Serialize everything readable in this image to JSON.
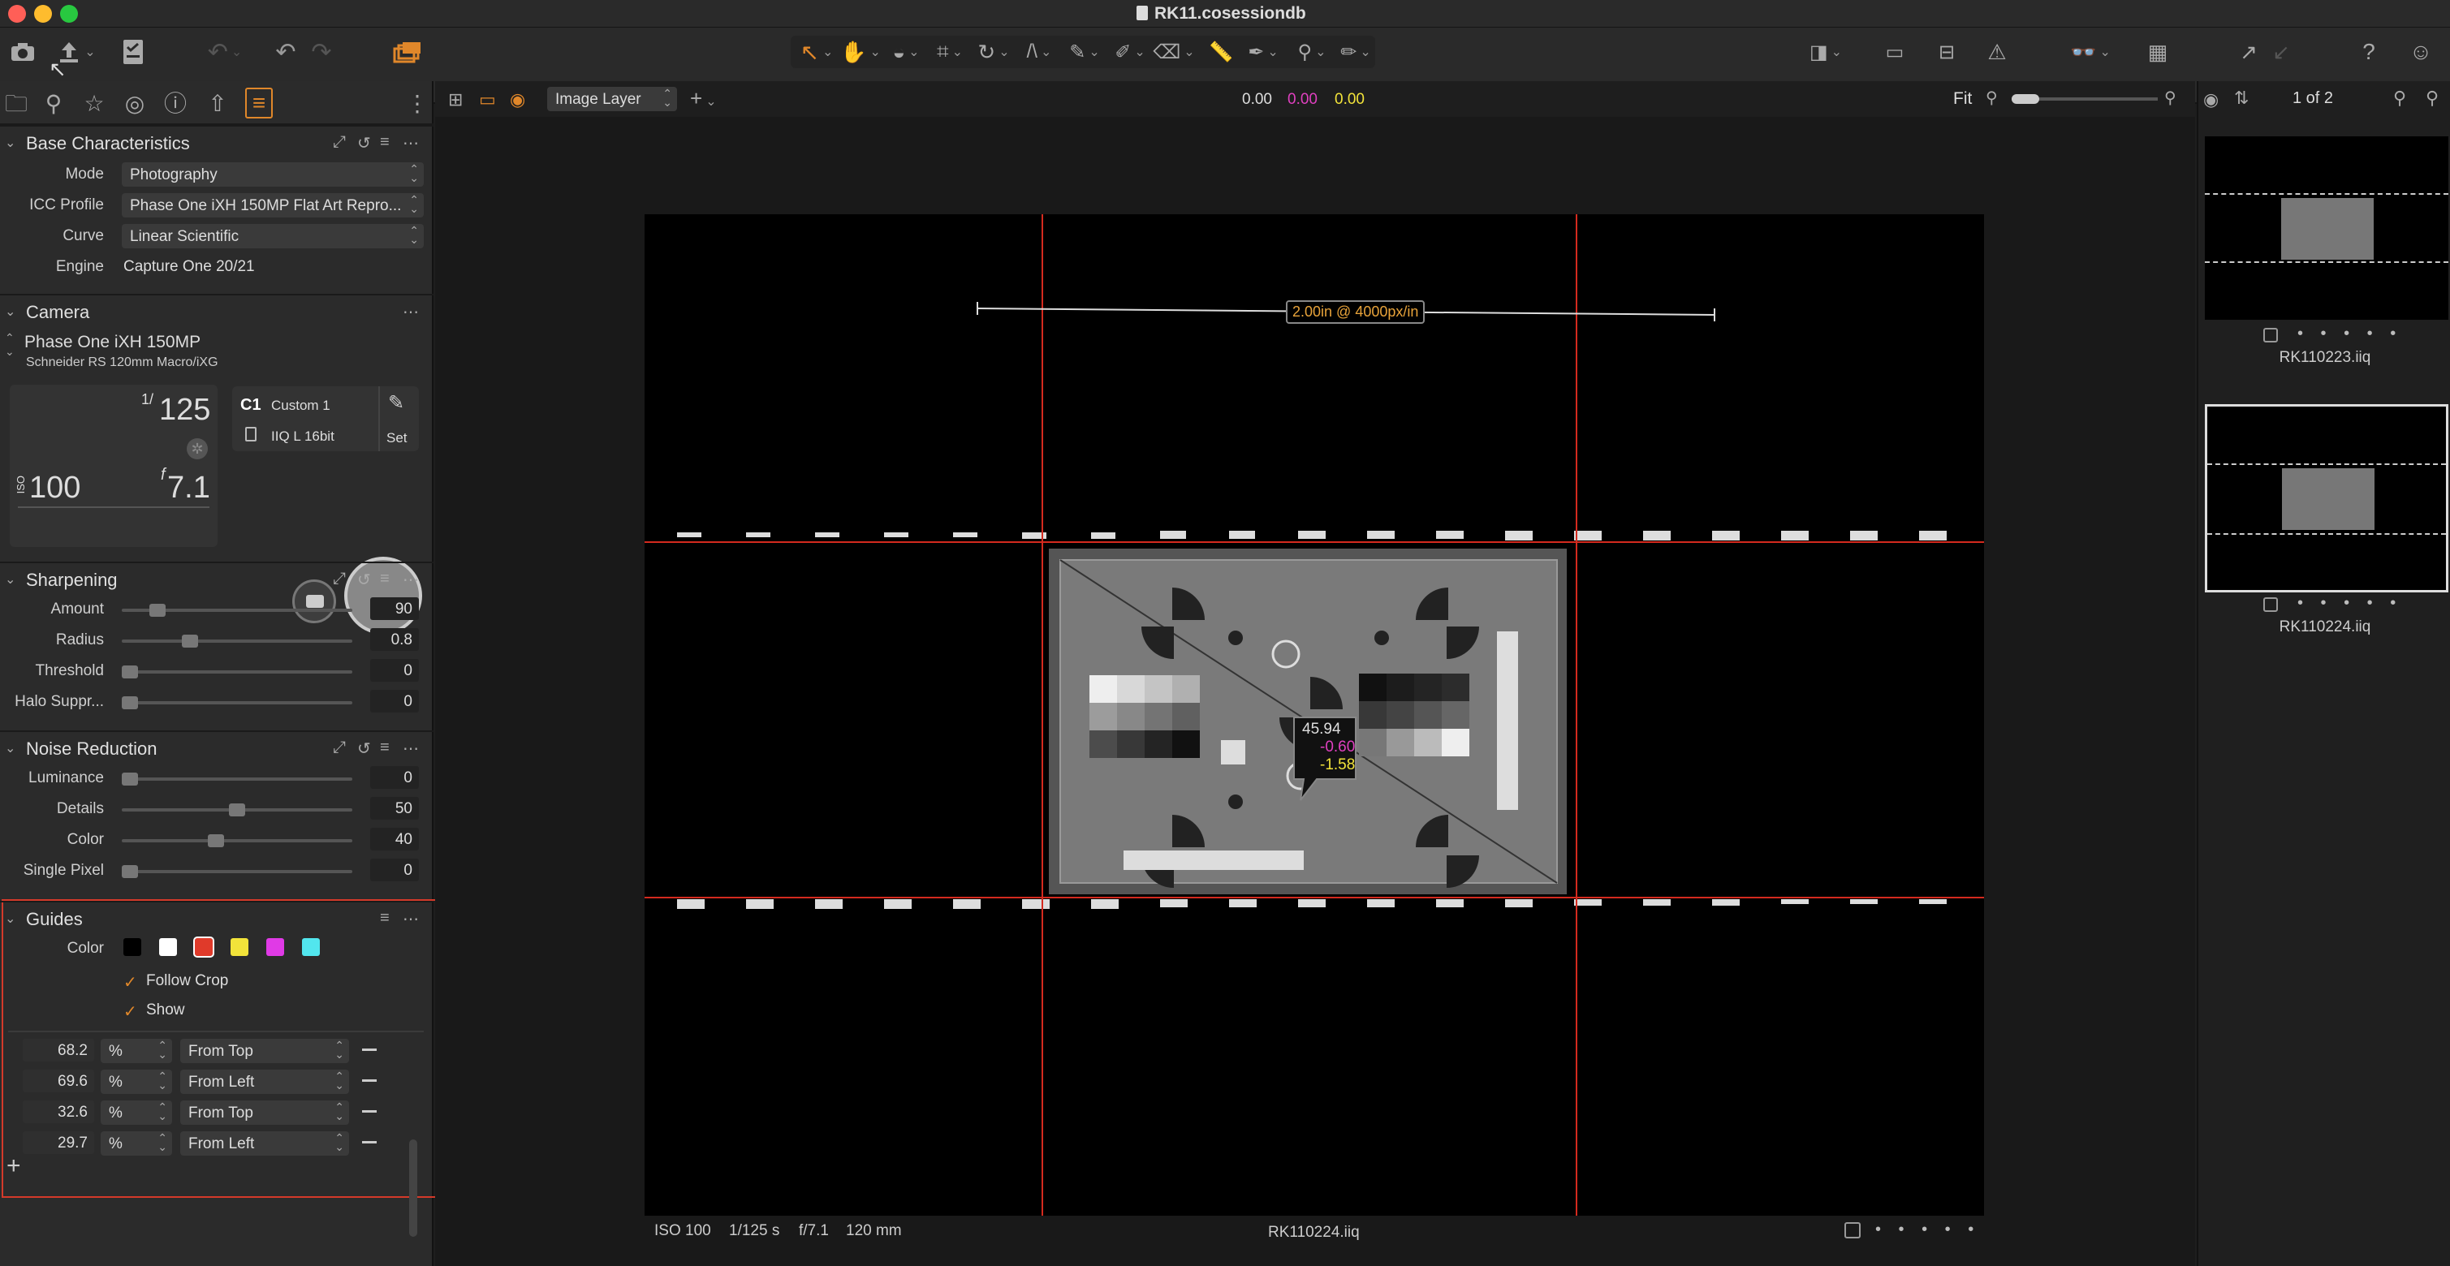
{
  "window": {
    "title": "RK11.cosessiondb"
  },
  "toolbar": {
    "left_icons": [
      "camera-icon",
      "upload-icon",
      "checklist-icon",
      "undo-history-icon",
      "undo-icon",
      "redo-icon",
      "variants-icon"
    ],
    "center_tools": [
      "select-cursor-icon",
      "pan-hand-icon",
      "loupe-icon",
      "crop-icon",
      "rotate-icon",
      "keystone-icon",
      "wb-picker-icon",
      "brush-icon",
      "eraser-icon",
      "ruler-icon",
      "color-picker-icon",
      "annotate-icon",
      "text-icon"
    ],
    "right_icons": [
      "view-mode-icon",
      "edit-icon",
      "grid-view-icon",
      "warning-icon",
      "proof-glasses-icon",
      "guides-grid-icon",
      "export-arrow-icon",
      "import-arrow-icon",
      "help-icon",
      "user-icon"
    ]
  },
  "left_panel": {
    "tabs": [
      "folder-icon",
      "search-adjust-icon",
      "star-icon",
      "color-wheel-icon",
      "info-icon",
      "export-icon",
      "details-icon",
      "more-icon"
    ],
    "base_characteristics": {
      "title": "Base Characteristics",
      "rows": [
        {
          "label": "Mode",
          "value": "Photography",
          "type": "select"
        },
        {
          "label": "ICC Profile",
          "value": "Phase One iXH 150MP Flat Art Repro...",
          "type": "select"
        },
        {
          "label": "Curve",
          "value": "Linear Scientific",
          "type": "select"
        },
        {
          "label": "Engine",
          "value": "Capture One 20/21",
          "type": "text"
        }
      ]
    },
    "camera": {
      "title": "Camera",
      "model": "Phase One iXH 150MP",
      "lens": "Schneider RS 120mm Macro/iXG",
      "shutter_prefix": "1/",
      "shutter": "125",
      "iso_label": "ISO",
      "iso": "100",
      "aperture_prefix": "f",
      "aperture": "7.1",
      "preset_badge": "C1",
      "preset_name": "Custom 1",
      "format": "IIQ L 16bit",
      "set_label": "Set"
    },
    "sharpening": {
      "title": "Sharpening",
      "rows": [
        {
          "label": "Amount",
          "value": "90",
          "pos": 0.13
        },
        {
          "label": "Radius",
          "value": "0.8",
          "pos": 0.28
        },
        {
          "label": "Threshold",
          "value": "0",
          "pos": 0.0
        },
        {
          "label": "Halo Suppr...",
          "value": "0",
          "pos": 0.0
        }
      ]
    },
    "noise_reduction": {
      "title": "Noise Reduction",
      "rows": [
        {
          "label": "Luminance",
          "value": "0",
          "pos": 0.0
        },
        {
          "label": "Details",
          "value": "50",
          "pos": 0.5
        },
        {
          "label": "Color",
          "value": "40",
          "pos": 0.4
        },
        {
          "label": "Single Pixel",
          "value": "0",
          "pos": 0.0
        }
      ]
    },
    "guides": {
      "title": "Guides",
      "color_label": "Color",
      "colors": [
        "#000000",
        "#ffffff",
        "#e03a2a",
        "#f2e33a",
        "#e03ae6",
        "#52e6ee"
      ],
      "selected_color": 2,
      "follow_crop_label": "Follow Crop",
      "follow_crop": true,
      "show_label": "Show",
      "show": true,
      "unit": "%",
      "add_label": "+",
      "list": [
        {
          "value": "68.2",
          "unit": "%",
          "ref": "From Top"
        },
        {
          "value": "69.6",
          "unit": "%",
          "ref": "From Left"
        },
        {
          "value": "32.6",
          "unit": "%",
          "ref": "From Top"
        },
        {
          "value": "29.7",
          "unit": "%",
          "ref": "From Left"
        }
      ]
    }
  },
  "viewer": {
    "layer_select": "Image Layer",
    "readout": {
      "a": "0.00",
      "b": "0.00",
      "c": "0.00"
    },
    "zoom_label": "Fit",
    "scale_label": "2.00in @ 4000px/in",
    "probe": {
      "l": "45.94",
      "a": "-0.60",
      "b": "-1.58"
    },
    "footer": {
      "iso": "ISO 100",
      "shutter": "1/125 s",
      "aperture": "f/7.1",
      "focal": "120 mm",
      "filename": "RK110224.iiq"
    },
    "guide_color": "#d42a1e"
  },
  "browser": {
    "counter": "1 of 2",
    "thumbs": [
      {
        "name": "RK110223.iiq",
        "selected": false
      },
      {
        "name": "RK110224.iiq",
        "selected": true
      }
    ],
    "rating_dots": "• • • • •"
  }
}
